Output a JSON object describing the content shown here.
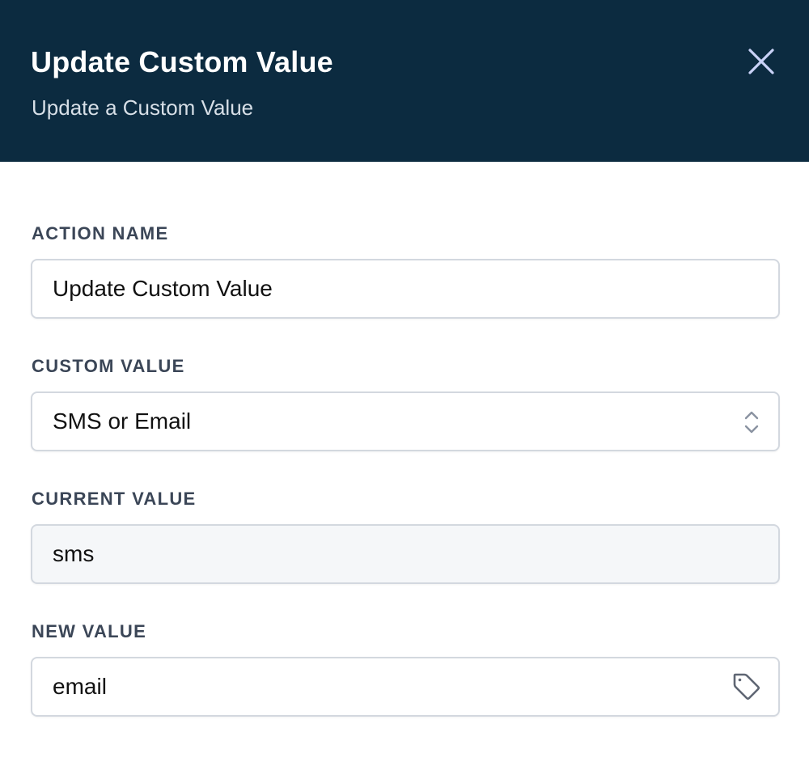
{
  "header": {
    "title": "Update Custom Value",
    "subtitle": "Update a Custom Value",
    "close_icon": "close-icon"
  },
  "fields": {
    "action_name": {
      "label": "ACTION NAME",
      "value": "Update Custom Value"
    },
    "custom_value": {
      "label": "CUSTOM VALUE",
      "selected": "SMS or Email",
      "icon": "chevron-up-down-icon"
    },
    "current_value": {
      "label": "CURRENT VALUE",
      "value": "sms"
    },
    "new_value": {
      "label": "NEW VALUE",
      "value": "email",
      "icon": "tag-icon"
    }
  },
  "colors": {
    "header_background": "#0c2b40",
    "label_text": "#3b4657",
    "input_border": "#d3d8df",
    "readonly_background": "#f5f7f9",
    "close_icon": "#c9d2f7"
  }
}
